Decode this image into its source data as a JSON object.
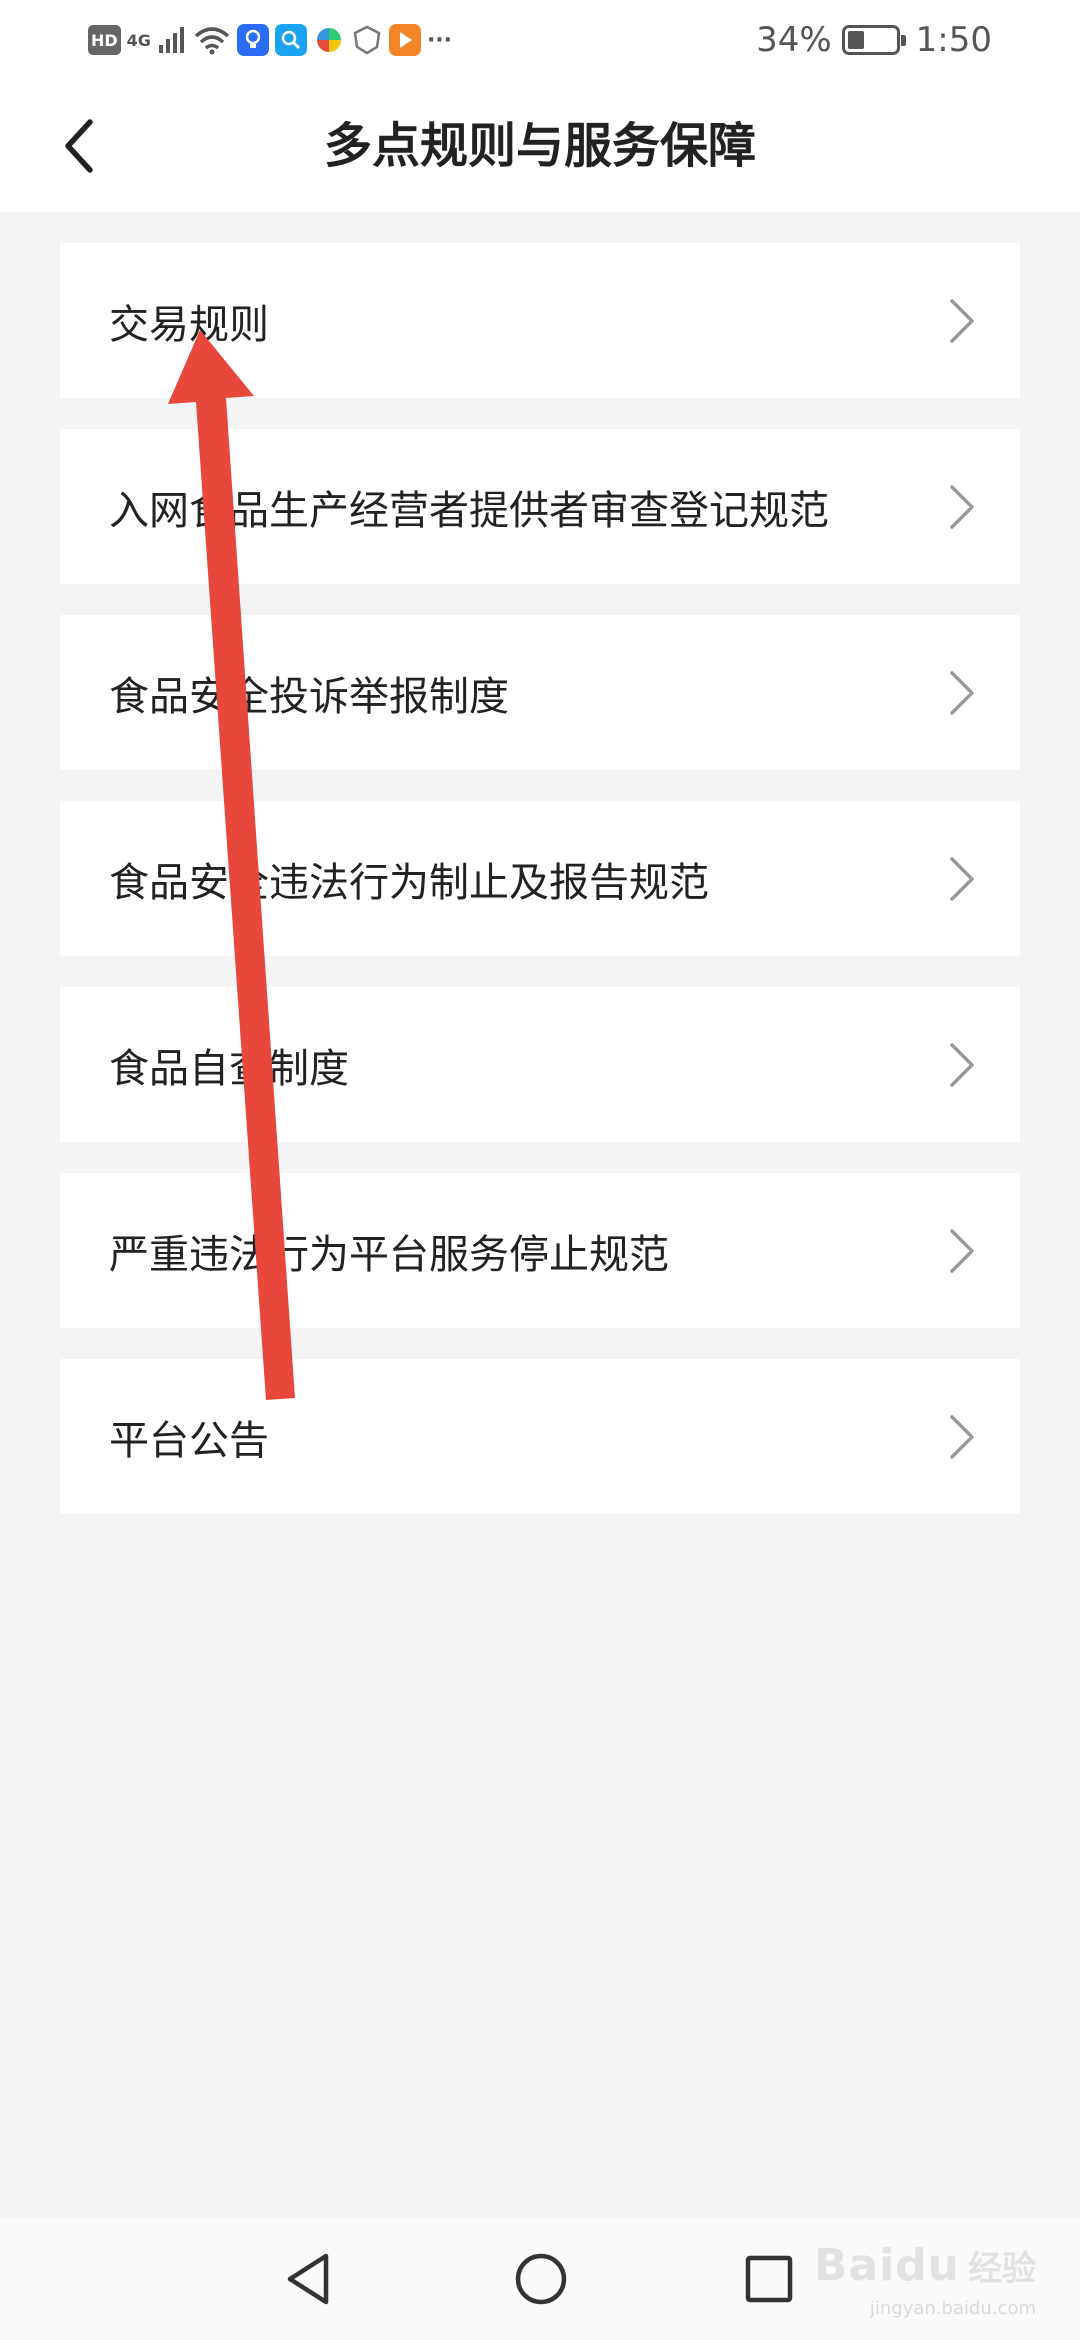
{
  "status_bar": {
    "hd_badge": "HD",
    "network": "4G",
    "battery_percent_text": "34%",
    "battery_level": 0.34,
    "time": "1:50",
    "more": "···",
    "apps": [
      {
        "icon": "bulb-app-icon",
        "color": "#2a6df4"
      },
      {
        "icon": "search-app-icon",
        "color": "#1aa3f0"
      },
      {
        "icon": "pinwheel-app-icon",
        "color": "#ffffff"
      },
      {
        "icon": "shield-app-icon",
        "color": "#888888"
      },
      {
        "icon": "play-app-icon",
        "color": "#f4862a"
      }
    ]
  },
  "header": {
    "title": "多点规则与服务保障",
    "back_icon": "chevron-left-icon"
  },
  "menu": {
    "items": [
      {
        "label": "交易规则"
      },
      {
        "label": "入网食品生产经营者提供者审查登记规范"
      },
      {
        "label": "食品安全投诉举报制度"
      },
      {
        "label": "食品安全违法行为制止及报告规范"
      },
      {
        "label": "食品自查制度"
      },
      {
        "label": "严重违法行为平台服务停止规范"
      },
      {
        "label": "平台公告"
      }
    ],
    "chevron_icon": "chevron-right-icon"
  },
  "annotation": {
    "type": "red-arrow",
    "color": "#e8473b"
  },
  "nav_bar": {
    "back": "triangle-back-icon",
    "home": "circle-home-icon",
    "recents": "square-recents-icon"
  },
  "watermark": {
    "brand": "Baidu",
    "cn": "经验",
    "sub": "jingyan.baidu.com"
  },
  "colors": {
    "background": "#f4f4f4",
    "card": "#ffffff",
    "text": "#222222",
    "chevron": "#9a9a9a"
  }
}
